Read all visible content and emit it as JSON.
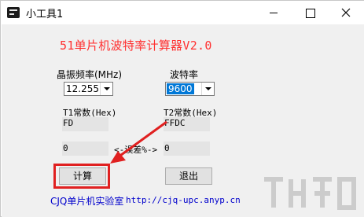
{
  "window": {
    "title": "小工具1"
  },
  "heading": "51单片机波特率计算器V2.0",
  "crystal": {
    "label": "晶振频率(MHz)",
    "value": "12.255"
  },
  "baud": {
    "label": "波特率",
    "value": "9600"
  },
  "t1": {
    "label": "T1常数(Hex)",
    "value": "FD"
  },
  "t2": {
    "label": "T2常数(Hex)",
    "value": "FFDC"
  },
  "error": {
    "label": "<-误差%->",
    "left_value": "0",
    "right_value": "0"
  },
  "buttons": {
    "calc": "计算",
    "exit": "退出"
  },
  "footer": {
    "name": "CJQ单片机实验室",
    "url": "http://cjq-upc.anyp.cn"
  },
  "colors": {
    "heading": "#ff3030",
    "highlight": "#e02020",
    "footer": "#0000cc",
    "selection": "#0078d7"
  },
  "icons": [
    "app-icon",
    "minimize-icon",
    "maximize-icon",
    "close-icon",
    "chevron-down-icon"
  ]
}
